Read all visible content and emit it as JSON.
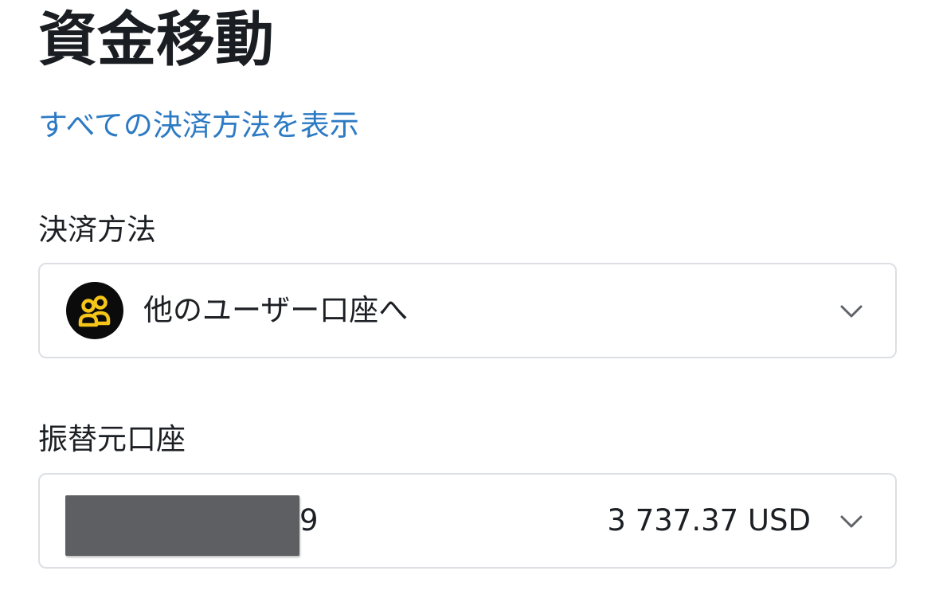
{
  "page": {
    "title": "資金移動",
    "show_all_link": "すべての決済方法を表示"
  },
  "payment_method": {
    "label": "決済方法",
    "selected_value": "他のユーザー口座へ",
    "icon": "users-icon",
    "icon_color": "#f5c518",
    "icon_background": "#0b0b0b"
  },
  "source_account": {
    "label": "振替元口座",
    "account_suffix": "9",
    "balance": "3 737.37 USD"
  },
  "colors": {
    "link": "#2d7ac4",
    "border": "#dcdfe3",
    "text": "#1c1f23",
    "redaction": "#5e5f63"
  }
}
